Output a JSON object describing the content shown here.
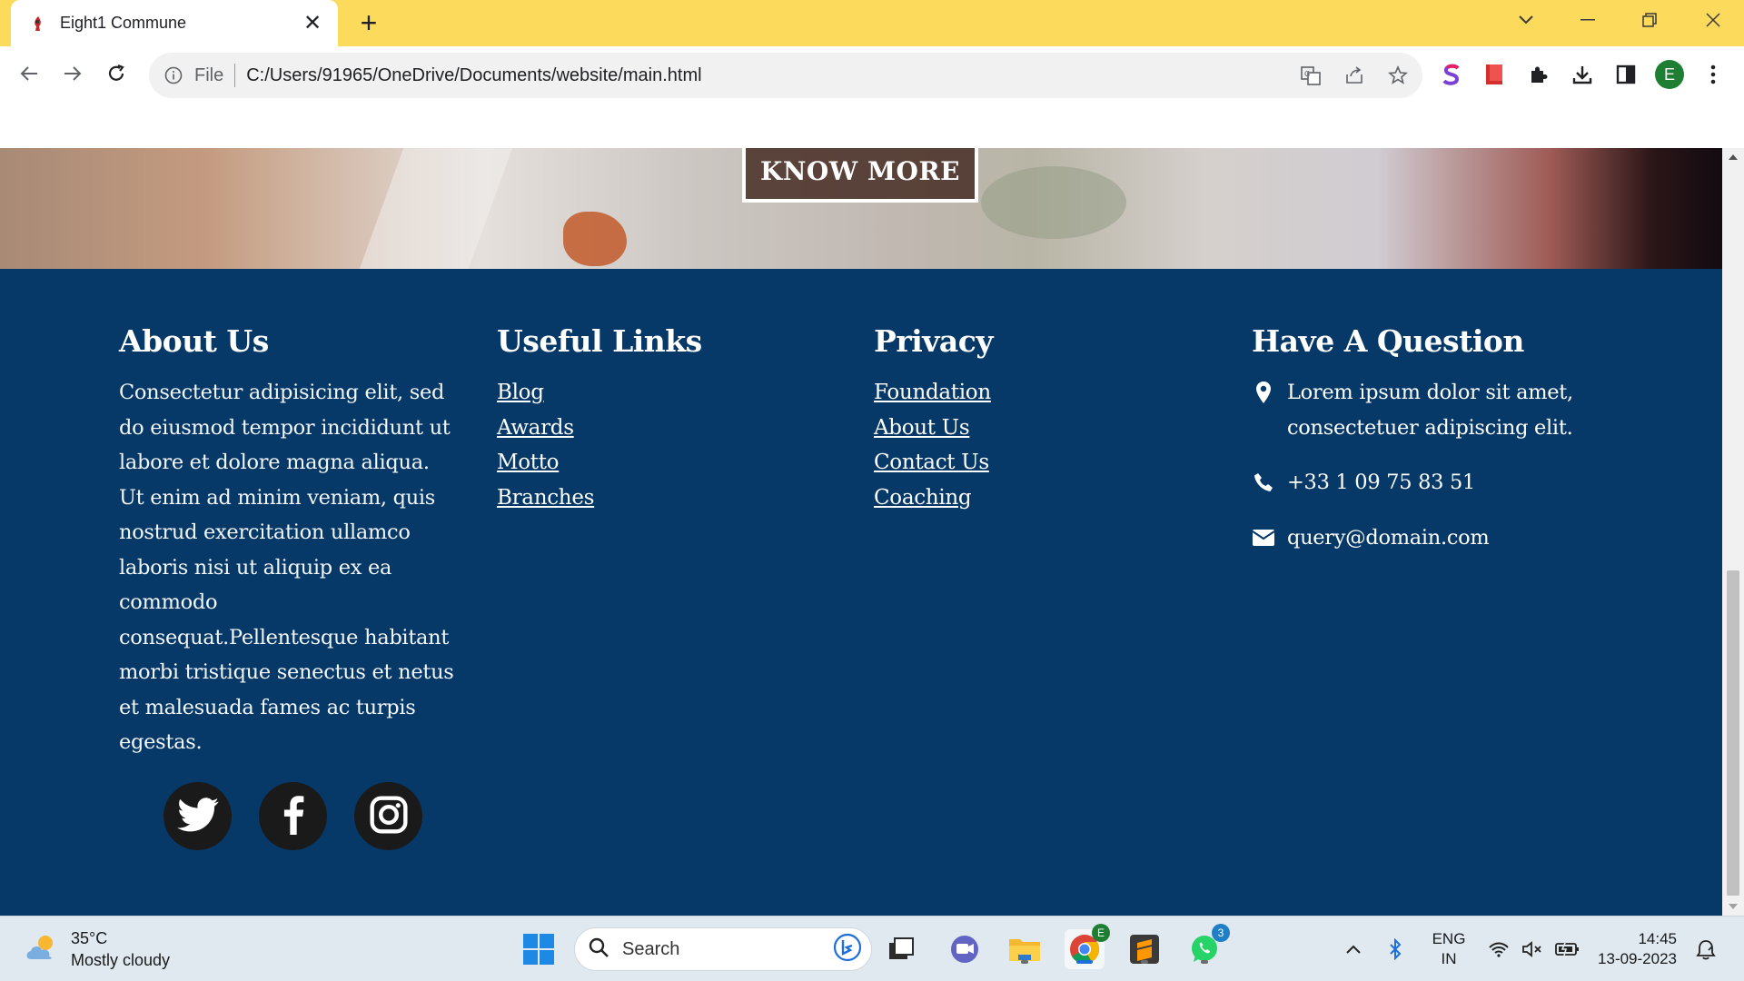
{
  "browser": {
    "tab_title": "Eight1 Commune",
    "omnibox_scheme": "File",
    "url": "C:/Users/91965/OneDrive/Documents/website/main.html",
    "profile_initial": "E"
  },
  "hero": {
    "cta_label": "KNOW MORE"
  },
  "footer": {
    "about": {
      "heading": "About Us",
      "text": "Consectetur adipisicing elit, sed do eiusmod tempor incididunt ut labore et dolore magna aliqua. Ut enim ad minim veniam, quis nostrud exercitation ullamco laboris nisi ut aliquip ex ea commodo consequat.Pellentesque habitant morbi tristique senectus et netus et malesuada fames ac turpis egestas."
    },
    "useful_links": {
      "heading": "Useful Links",
      "items": [
        "Blog",
        "Awards",
        "Motto",
        "Branches"
      ]
    },
    "privacy": {
      "heading": "Privacy",
      "items": [
        "Foundation",
        "About Us",
        "Contact Us",
        "Coaching"
      ]
    },
    "question": {
      "heading": "Have A Question",
      "address": "Lorem ipsum dolor sit amet, consectetuer adipiscing elit.",
      "phone": "+33 1 09 75 83 51",
      "email": "query@domain.com"
    },
    "socials": [
      "twitter-icon",
      "facebook-icon",
      "instagram-icon"
    ]
  },
  "taskbar": {
    "temperature": "35°C",
    "weather": "Mostly cloudy",
    "search_placeholder": "Search",
    "chrome_badge": "E",
    "whatsapp_badge": "3",
    "language_line1": "ENG",
    "language_line2": "IN",
    "time": "14:45",
    "date": "13-09-2023"
  },
  "colors": {
    "tabstrip": "#fbda5c",
    "footer_bg": "#063968",
    "social_bg": "#1a1a1a"
  }
}
